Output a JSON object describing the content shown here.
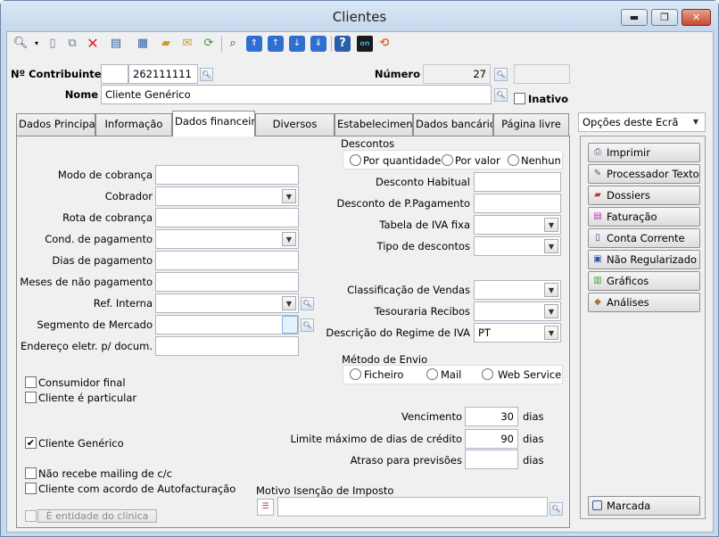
{
  "window": {
    "title": "Clientes",
    "min": "▬",
    "max": "❐",
    "close": "✕"
  },
  "toolbar": {
    "icons": [
      "search-icon",
      "new-doc-icon",
      "copy-icon",
      "delete-icon",
      "properties-icon",
      "grid-icon",
      "open-folder-icon",
      "export-icon",
      "refresh-icon",
      "preview-icon",
      "first-icon",
      "prev-icon",
      "next-icon",
      "last-icon",
      "help-icon",
      "on-icon",
      "sync-icon"
    ]
  },
  "header": {
    "contribuinte_label": "Nº Contribuinte",
    "contribuinte_prefix": "",
    "contribuinte_value": "262111111",
    "numero_label": "Número",
    "numero_value": "27",
    "numero_extra": "",
    "nome_label": "Nome",
    "nome_value": "Cliente Genérico",
    "inativo_label": "Inativo"
  },
  "tabs": [
    "Dados Principais",
    "Informação",
    "Dados financeiros",
    "Diversos",
    "Estabelecimentos",
    "Dados bancários",
    "Página livre"
  ],
  "active_tab": 2,
  "left_fields": {
    "modo_cobranca": "Modo de cobrança",
    "cobrador": "Cobrador",
    "rota_cobranca": "Rota de cobrança",
    "cond_pagamento": "Cond. de pagamento",
    "dias_pagamento": "Dias de pagamento",
    "meses_nao_pagamento": "Meses de não pagamento",
    "ref_interna": "Ref. Interna",
    "segmento_mercado": "Segmento de Mercado",
    "endereco_eletr": "Endereço eletr. p/ docum."
  },
  "checkboxes": {
    "consumidor_final": {
      "label": "Consumidor final",
      "checked": false
    },
    "cliente_particular": {
      "label": "Cliente é particular",
      "checked": false
    },
    "cliente_generico": {
      "label": "Cliente Genérico",
      "checked": true
    },
    "nao_recebe_mailing": {
      "label": "Não recebe mailing de c/c",
      "checked": false
    },
    "acordo_autofacturacao": {
      "label": "Cliente com acordo de  Autofacturação",
      "checked": false
    },
    "entidade_clinica": {
      "label": "É entidade do clínica",
      "checked": false
    }
  },
  "descontos": {
    "group_label": "Descontos",
    "options": [
      "Por quantidade",
      "Por valor",
      "Nenhum"
    ],
    "desconto_habitual": "Desconto Habitual",
    "desconto_pp": "Desconto de P.Pagamento",
    "tabela_iva": "Tabela de IVA fixa",
    "tipo_descontos": "Tipo de descontos"
  },
  "classificacao": {
    "class_vendas": "Classificação de Vendas",
    "tesouraria": "Tesouraria Recibos",
    "regime_iva": "Descrição do Regime de IVA",
    "regime_iva_value": "PT"
  },
  "metodo_envio": {
    "label": "Método de Envio",
    "options": [
      "Ficheiro",
      "Mail",
      "Web Service"
    ]
  },
  "vencimento": {
    "label": "Vencimento",
    "value": "30",
    "unit": "dias"
  },
  "limite": {
    "label": "Limite máximo de dias de crédito",
    "value": "90",
    "unit": "dias"
  },
  "atraso": {
    "label": "Atraso para previsões",
    "value": "",
    "unit": "dias"
  },
  "motivo": {
    "label": "Motivo Isenção de Imposto",
    "value": ""
  },
  "side": {
    "dropdown": "Opções deste Ecrã",
    "buttons": [
      {
        "label": "Imprimir",
        "icon": "printer-icon"
      },
      {
        "label": "Processador Texto",
        "icon": "text-editor-icon"
      },
      {
        "label": "Dossiers",
        "icon": "dossiers-icon"
      },
      {
        "label": "Faturação",
        "icon": "invoice-icon"
      },
      {
        "label": "Conta Corrente",
        "icon": "account-icon"
      },
      {
        "label": "Não Regularizado",
        "icon": "unsettled-icon"
      },
      {
        "label": "Gráficos",
        "icon": "chart-icon"
      },
      {
        "label": "Análises",
        "icon": "analysis-icon"
      }
    ],
    "marcada": "Marcada"
  }
}
